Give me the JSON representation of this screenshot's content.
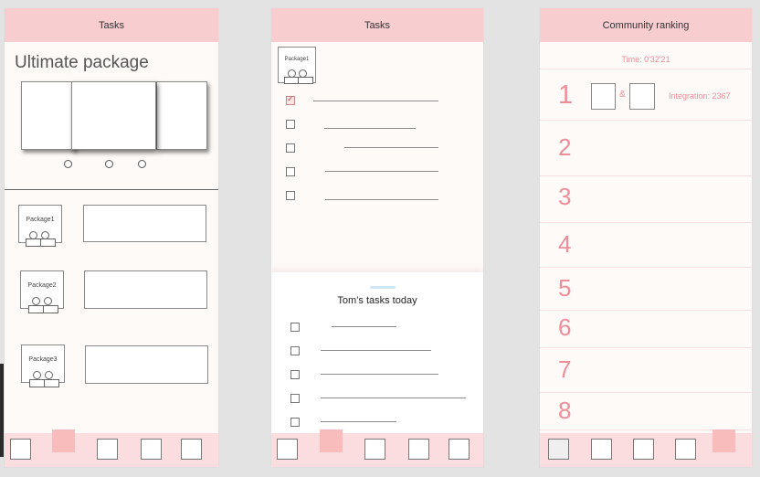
{
  "screens": [
    {
      "header_title": "Tasks",
      "package_title": "Ultimate package",
      "packages": [
        {
          "label": "Package1"
        },
        {
          "label": "Package2"
        },
        {
          "label": "Package3"
        }
      ]
    },
    {
      "header_title": "Tasks",
      "package_label": "Package1",
      "sheet_title": "Tom’s tasks today"
    },
    {
      "header_title": "Community ranking",
      "time_label": "Time: 0'32'21",
      "ampersand": "&",
      "integration": "Integration: 2367",
      "ranks": [
        "1",
        "2",
        "3",
        "4",
        "5",
        "6",
        "7",
        "8"
      ]
    }
  ],
  "colors": {
    "accent": "#f8cdd0",
    "rank_number": "#ef8d9a",
    "tabbar": "#fbdde0"
  }
}
